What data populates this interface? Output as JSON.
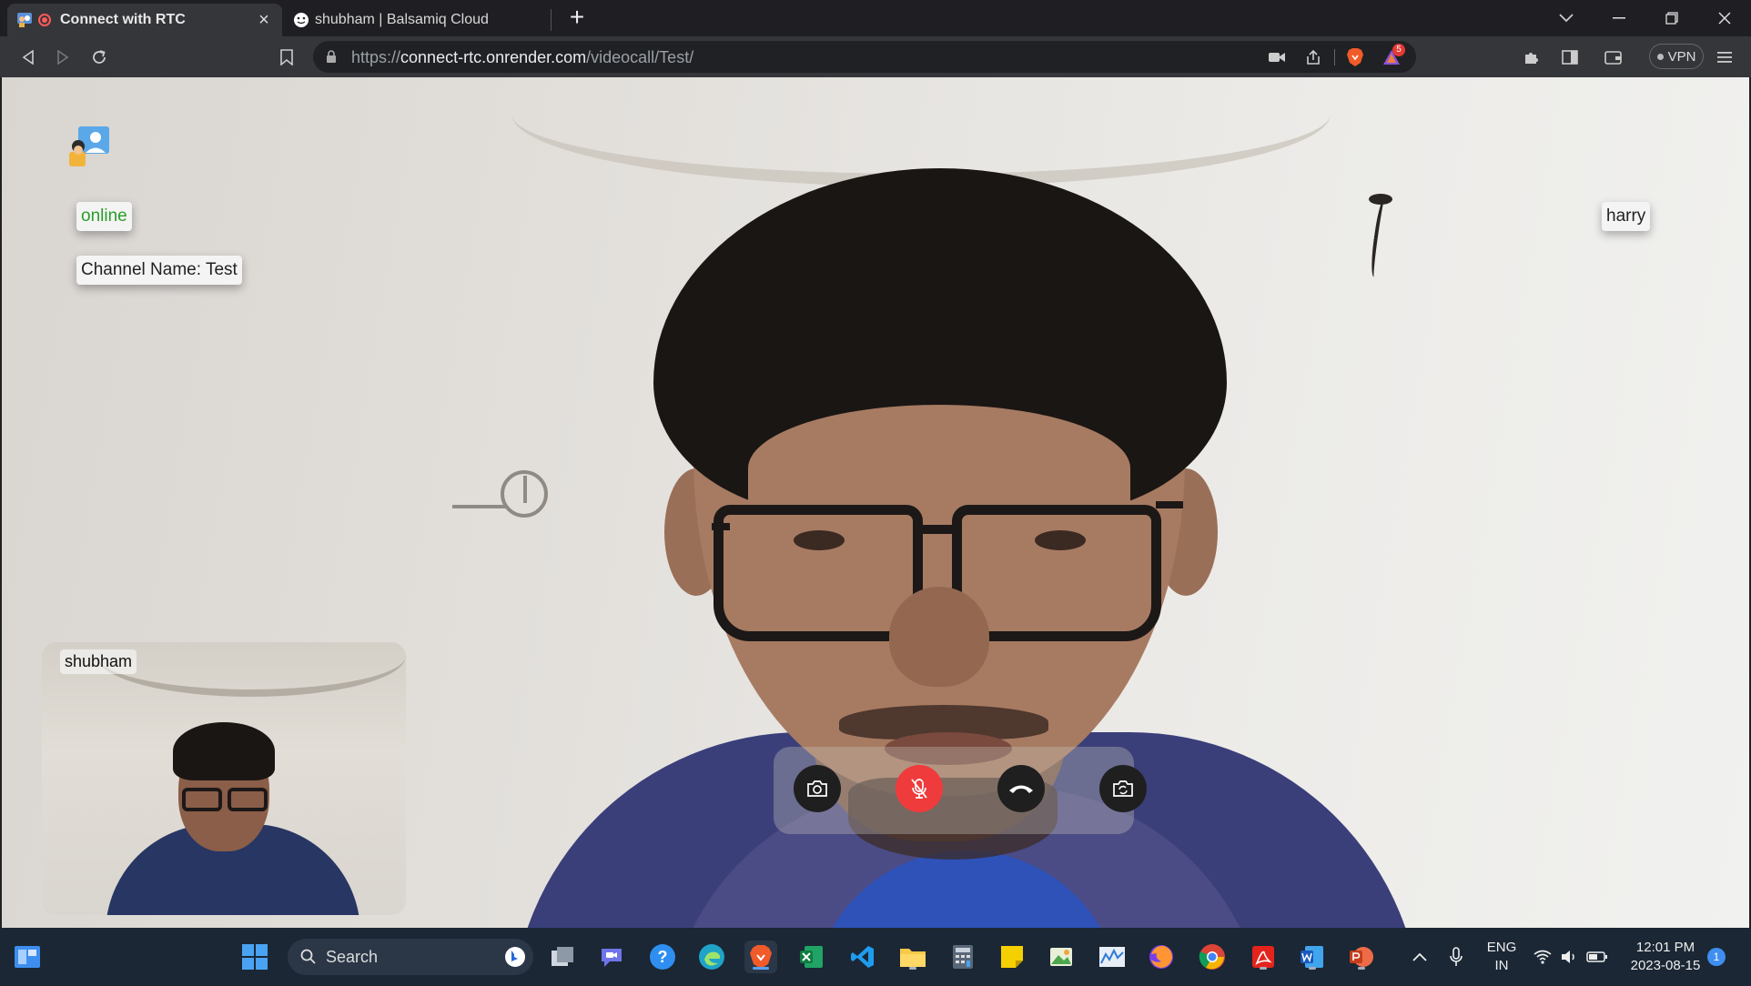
{
  "browser": {
    "tabs": [
      {
        "title": "Connect with RTC",
        "active": true,
        "recording": true
      },
      {
        "title": "shubham | Balsamiq Cloud",
        "active": false
      }
    ],
    "url_scheme": "https://",
    "url_host": "connect-rtc.onrender.com",
    "url_path": "/videocall/Test/",
    "shields_badge": "5",
    "vpn_label": "VPN"
  },
  "call": {
    "status": "online",
    "channel_label": "Channel Name: Test",
    "remote_user": "harry",
    "local_user": "shubham",
    "controls": [
      {
        "name": "camera",
        "icon": "camera-icon",
        "state": "on"
      },
      {
        "name": "microphone",
        "icon": "mic-off-icon",
        "state": "muted"
      },
      {
        "name": "end-call",
        "icon": "phone-hangup-icon",
        "state": "active"
      },
      {
        "name": "switch-camera",
        "icon": "camera-switch-icon",
        "state": "on"
      }
    ],
    "accent_colors": {
      "online": "#2a9d2a",
      "muted": "#ef3b3b"
    }
  },
  "taskbar": {
    "search_placeholder": "Search",
    "language": "ENG",
    "region": "IN",
    "time": "12:01 PM",
    "date": "2023-08-15",
    "notification_count": "1"
  }
}
